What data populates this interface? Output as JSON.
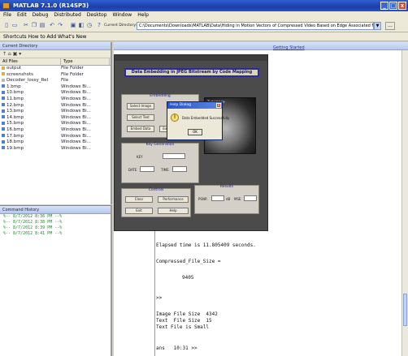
{
  "window": {
    "title": "MATLAB 7.1.0 (R14SP3)",
    "min": "_",
    "max": "□",
    "close": "x"
  },
  "menu": [
    "File",
    "Edit",
    "Debug",
    "Distributed",
    "Desktop",
    "Window",
    "Help"
  ],
  "toolbar": {
    "icons": [
      "new-icon",
      "open-icon",
      "cut-icon",
      "copy-icon",
      "paste-icon",
      "undo-icon",
      "redo-icon",
      "simulink-icon",
      "guide-icon",
      "profiler-icon",
      "help-icon"
    ],
    "current_dir_label": "Current Directory:",
    "current_dir": "C:\\Documents\\Downloads\\MATLAB\\Data\\Hiding in Motion Vectors of Compressed Video Based on Edge Associated Modification",
    "dropdown": "▼",
    "browse": "..."
  },
  "shortcuts": "Shortcuts  How to Add  What's New",
  "left_panel": {
    "title": "Current Directory",
    "tools": "↑ ⌂ ▣ ▾",
    "columns": [
      "All Files",
      "Type"
    ],
    "files": [
      {
        "name": "output",
        "type": "File Folder"
      },
      {
        "name": "screenshots",
        "type": "File Folder"
      },
      {
        "name": "Decoder_lossy_Rel",
        "type": "File"
      },
      {
        "name": "1.bmp",
        "type": "Windows Bi..."
      },
      {
        "name": "10.bmp",
        "type": "Windows Bi..."
      },
      {
        "name": "11.bmp",
        "type": "Windows Bi..."
      },
      {
        "name": "12.bmp",
        "type": "Windows Bi..."
      },
      {
        "name": "13.bmp",
        "type": "Windows Bi..."
      },
      {
        "name": "14.bmp",
        "type": "Windows Bi..."
      },
      {
        "name": "15.bmp",
        "type": "Windows Bi..."
      },
      {
        "name": "16.bmp",
        "type": "Windows Bi..."
      },
      {
        "name": "17.bmp",
        "type": "Windows Bi..."
      },
      {
        "name": "18.bmp",
        "type": "Windows Bi..."
      },
      {
        "name": "19.bmp",
        "type": "Windows Bi..."
      }
    ]
  },
  "history": {
    "title": "Command History",
    "rows": [
      "%-- 8/7/2012  8:36 PM --%",
      "%-- 8/7/2012  8:38 PM --%",
      "%-- 8/7/2012  8:39 PM --%",
      "%-- 8/7/2012  8:41 PM --%"
    ]
  },
  "right_panel": {
    "link": "Getting Started"
  },
  "command": {
    "elapsed": "Elapsed time is 11.805409 seconds.",
    "compressed": "Compressed_File_Size =",
    "value": "9405",
    "gt": ">>",
    "image_size": "Image File Size  4342",
    "text_size": "Text  File Size  15",
    "text_is": "Text File is Small",
    "prompt": "ans   10:31 >>"
  },
  "figure": {
    "banner": "Data Embedding in JPEG Bitstream by Code Mapping",
    "panel1": {
      "title": "Embedding",
      "btns": [
        "Select Image",
        "Select Text",
        "Embed Data",
        "Extract Data"
      ]
    },
    "panel2": {
      "title": "Key Generation",
      "labels": [
        "KEY",
        "DATE",
        "TIME"
      ],
      "values": [
        "",
        "",
        ""
      ]
    },
    "panel3": {
      "title": "Controls",
      "btns": [
        "Clear",
        "Performance",
        "Exit",
        "Help"
      ]
    },
    "panel4": {
      "title": "Results",
      "labels": [
        "PSNR",
        "MSE"
      ],
      "units": [
        "dB",
        ""
      ]
    },
    "image_label": "Test Image"
  },
  "msgbox": {
    "title": "Help Dialog",
    "close": "x",
    "text": "Data Embedded Successfully",
    "ok": "OK",
    "icon": "!"
  }
}
